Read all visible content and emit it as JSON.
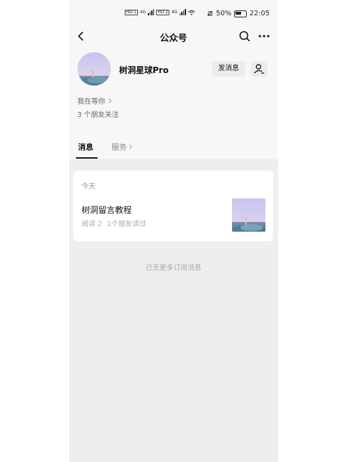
{
  "status_bar": {
    "sim1_tag": "HD 1",
    "sim2_tag": "HD 2",
    "network1": "4G",
    "network2": "4G",
    "battery_percent": "50%",
    "time": "22:05",
    "icons": [
      "signal-icon",
      "wifi-icon",
      "mute-icon",
      "battery-icon"
    ]
  },
  "nav": {
    "title": "公众号",
    "icons": [
      "back-icon",
      "search-icon",
      "more-icon"
    ]
  },
  "profile": {
    "name": "树洞星球Pro",
    "send_label": "发消息",
    "waiting_text": "我在等你",
    "followers_text": "3 个朋友关注",
    "colors": {
      "button_bg": "#ececec"
    }
  },
  "tabs": [
    {
      "label": "消息",
      "active": true
    },
    {
      "label": "服务",
      "active": false
    }
  ],
  "feed": {
    "date_label": "今天",
    "articles": [
      {
        "title": "树洞留言教程",
        "reads": "阅读 2",
        "friends_read": "1个朋友读过"
      }
    ],
    "end_note": "已无更多订阅消息"
  },
  "colors": {
    "page_bg": "#ffffff",
    "header_bg": "#f7f7f7",
    "feed_bg": "#eeedf0",
    "card_bg": "#ffffff"
  }
}
